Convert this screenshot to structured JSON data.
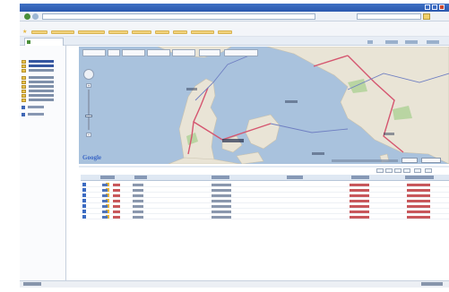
{
  "browser": {
    "title": "",
    "url": "",
    "search_placeholder": "",
    "menu": [
      "",
      "",
      "",
      "",
      "",
      ""
    ],
    "active_tab": ""
  },
  "sidebar": {
    "header": "",
    "items": [
      {
        "label": "",
        "icon": "folder-icon"
      },
      {
        "label": "",
        "icon": "folder-icon"
      },
      {
        "label": "",
        "icon": "folder-icon"
      },
      {
        "label": "",
        "icon": "folder-icon"
      },
      {
        "label": "",
        "icon": "folder-icon"
      },
      {
        "label": "",
        "icon": "folder-icon"
      },
      {
        "label": "",
        "icon": "folder-icon"
      },
      {
        "label": "",
        "icon": "folder-icon"
      },
      {
        "label": "",
        "icon": "folder-icon"
      }
    ],
    "links": [
      "",
      ""
    ]
  },
  "map": {
    "provider_logo": "Google",
    "zoom_in": "+",
    "zoom_out": "−",
    "map_types": [
      "",
      ""
    ],
    "land_color": "#e9e4d6",
    "water_color": "#a9c2dd",
    "road_color_primary": "#d5556f",
    "road_color_secondary": "#6f7fc2",
    "park_color": "#b9d5a2"
  },
  "list": {
    "title": "",
    "columns": [
      "",
      "",
      "",
      "",
      "",
      ""
    ],
    "rows": [
      {
        "status": "ok"
      },
      {
        "status": "ok"
      },
      {
        "status": "ok"
      },
      {
        "status": "ok"
      },
      {
        "status": "ok"
      },
      {
        "status": "ok"
      },
      {
        "status": "ok"
      }
    ]
  },
  "status": {
    "text": "",
    "zone": "",
    "zoom": ""
  }
}
